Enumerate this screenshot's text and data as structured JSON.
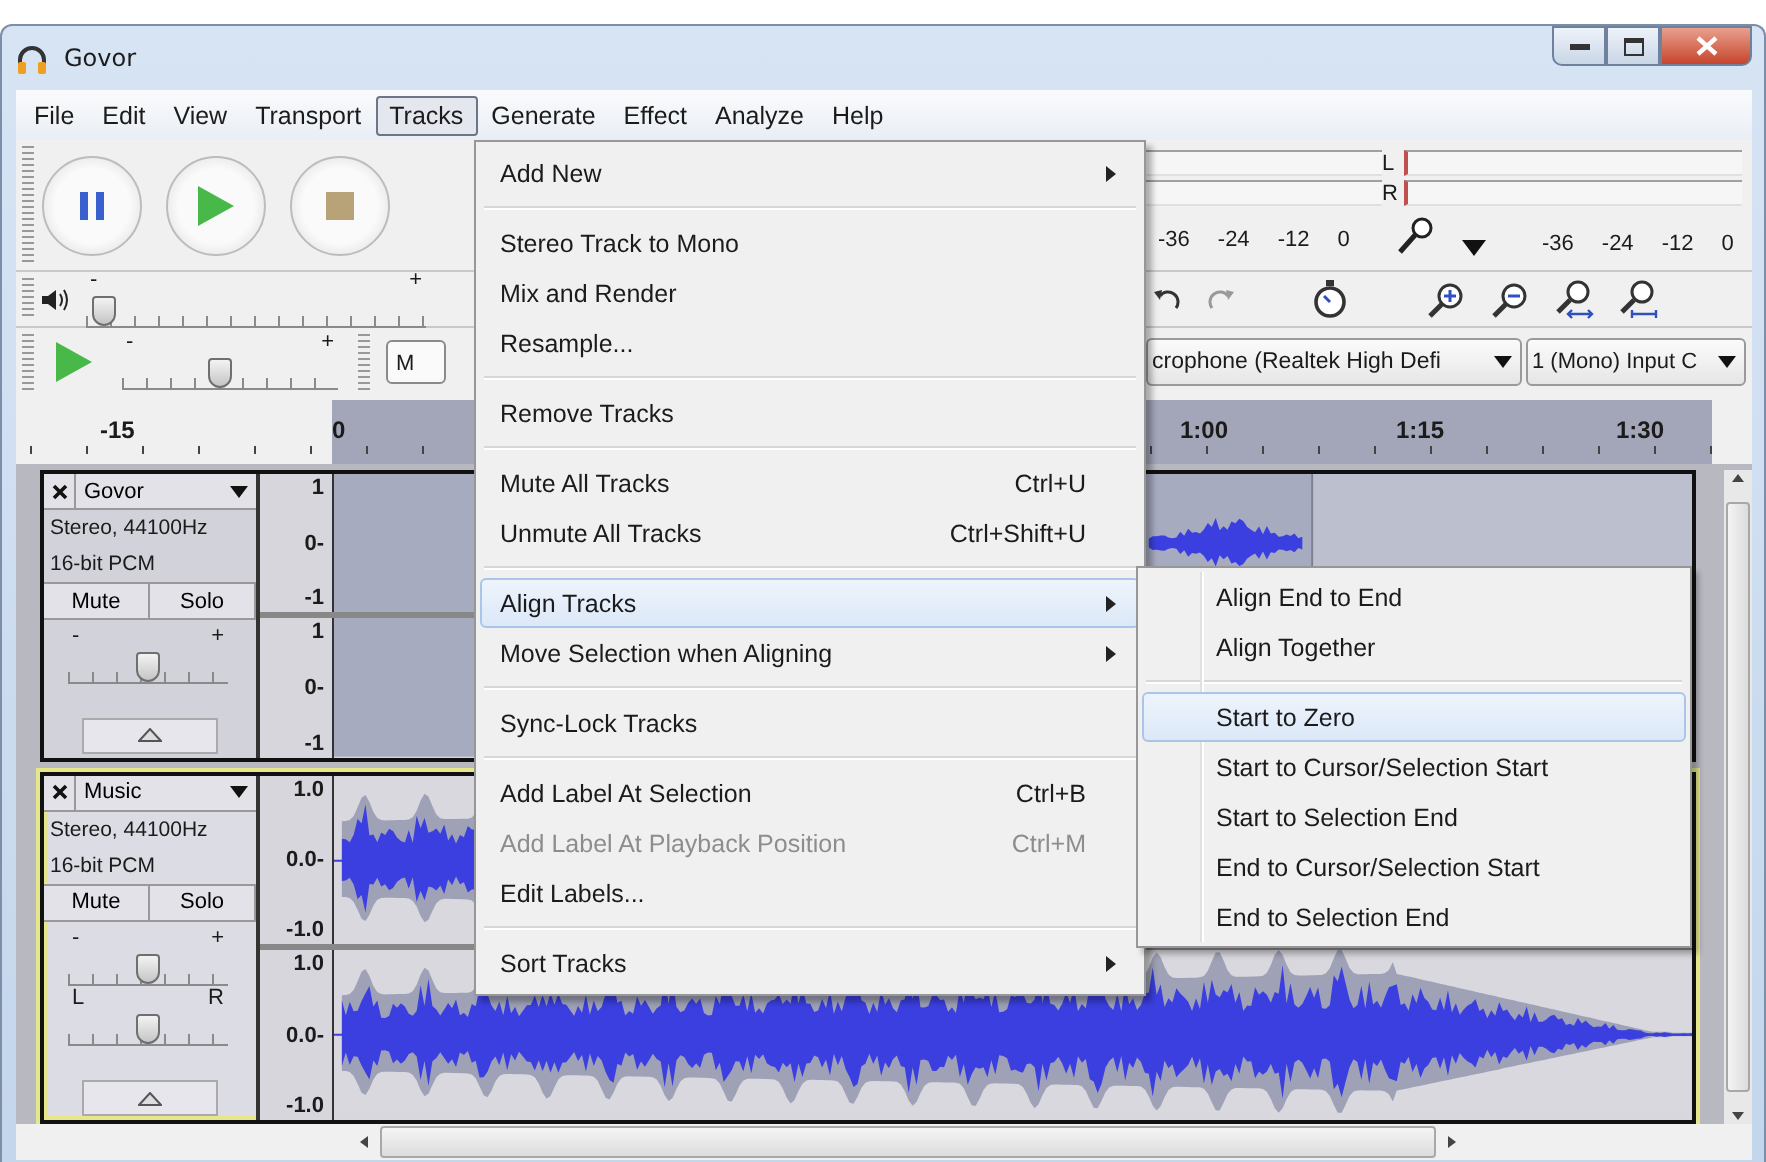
{
  "window": {
    "title": "Govor"
  },
  "menu_bar": [
    {
      "label": "File",
      "selected": false
    },
    {
      "label": "Edit",
      "selected": false
    },
    {
      "label": "View",
      "selected": false
    },
    {
      "label": "Transport",
      "selected": false
    },
    {
      "label": "Tracks",
      "selected": true
    },
    {
      "label": "Generate",
      "selected": false
    },
    {
      "label": "Effect",
      "selected": false
    },
    {
      "label": "Analyze",
      "selected": false
    },
    {
      "label": "Help",
      "selected": false
    }
  ],
  "meter_toolbar": {
    "channels": [
      "L",
      "R"
    ],
    "playback_scale": [
      "-36",
      "-24",
      "-12",
      "0"
    ],
    "recording_scale": [
      "-36",
      "-24",
      "-12",
      "0"
    ]
  },
  "mixer_toolbar": {
    "volume_slider": {
      "min_label": "-",
      "max_label": "+",
      "level": 0.02
    }
  },
  "transcription_toolbar": {
    "speed_slider": {
      "min_label": "-",
      "max_label": "+",
      "level": 0.45
    },
    "partial_box": "M"
  },
  "device_toolbar": {
    "input_device": "crophone (Realtek High Defi",
    "input_channels": "1 (Mono) Input C"
  },
  "timeline": {
    "labels": [
      "-15",
      "0",
      "1:00",
      "1:15",
      "1:30"
    ]
  },
  "tracks": [
    {
      "name": "Govor",
      "format": "Stereo, 44100Hz",
      "sample_format": "16-bit PCM",
      "mute": "Mute",
      "solo": "Solo",
      "selected": false,
      "sliders": [
        {
          "kind": "gain",
          "min_label": "-",
          "max_label": "+",
          "level": 0.5
        }
      ],
      "channels": [
        {
          "scale": [
            "1",
            "0-",
            "-1"
          ]
        },
        {
          "scale": [
            "1",
            "0-",
            "-1"
          ]
        }
      ]
    },
    {
      "name": "Music",
      "format": "Stereo, 44100Hz",
      "sample_format": "16-bit PCM",
      "mute": "Mute",
      "solo": "Solo",
      "selected": true,
      "sliders": [
        {
          "kind": "gain",
          "min_label": "-",
          "max_label": "+",
          "level": 0.5
        },
        {
          "kind": "pan",
          "min_label": "L",
          "max_label": "R",
          "level": 0.5
        }
      ],
      "channels": [
        {
          "scale": [
            "1.0",
            "0.0-",
            "-1.0"
          ]
        },
        {
          "scale": [
            "1.0",
            "0.0-",
            "-1.0"
          ]
        }
      ]
    }
  ],
  "tracks_menu": [
    {
      "kind": "item",
      "label": "Add New",
      "has_submenu": true,
      "selected": false,
      "disabled": false
    },
    {
      "kind": "separator"
    },
    {
      "kind": "item",
      "label": "Stereo Track to Mono",
      "has_submenu": false,
      "selected": false,
      "disabled": false
    },
    {
      "kind": "item",
      "label": "Mix and Render",
      "has_submenu": false,
      "selected": false,
      "disabled": false
    },
    {
      "kind": "item",
      "label": "Resample...",
      "has_submenu": false,
      "selected": false,
      "disabled": false
    },
    {
      "kind": "separator"
    },
    {
      "kind": "item",
      "label": "Remove Tracks",
      "has_submenu": false,
      "selected": false,
      "disabled": false
    },
    {
      "kind": "separator"
    },
    {
      "kind": "item",
      "label": "Mute All Tracks",
      "shortcut": "Ctrl+U",
      "has_submenu": false,
      "selected": false,
      "disabled": false
    },
    {
      "kind": "item",
      "label": "Unmute All Tracks",
      "shortcut": "Ctrl+Shift+U",
      "has_submenu": false,
      "selected": false,
      "disabled": false
    },
    {
      "kind": "separator"
    },
    {
      "kind": "item",
      "label": "Align Tracks",
      "has_submenu": true,
      "selected": true,
      "disabled": false
    },
    {
      "kind": "item",
      "label": "Move Selection when Aligning",
      "has_submenu": true,
      "selected": false,
      "disabled": false
    },
    {
      "kind": "separator"
    },
    {
      "kind": "item",
      "label": "Sync-Lock Tracks",
      "has_submenu": false,
      "selected": false,
      "disabled": false
    },
    {
      "kind": "separator"
    },
    {
      "kind": "item",
      "label": "Add Label At Selection",
      "shortcut": "Ctrl+B",
      "has_submenu": false,
      "selected": false,
      "disabled": false
    },
    {
      "kind": "item",
      "label": "Add Label At Playback Position",
      "shortcut": "Ctrl+M",
      "has_submenu": false,
      "selected": false,
      "disabled": true
    },
    {
      "kind": "item",
      "label": "Edit Labels...",
      "has_submenu": false,
      "selected": false,
      "disabled": false
    },
    {
      "kind": "separator"
    },
    {
      "kind": "item",
      "label": "Sort Tracks",
      "has_submenu": true,
      "selected": false,
      "disabled": false
    }
  ],
  "align_submenu": [
    {
      "kind": "item",
      "label": "Align End to End",
      "selected": false
    },
    {
      "kind": "item",
      "label": "Align Together",
      "selected": false
    },
    {
      "kind": "separator"
    },
    {
      "kind": "item",
      "label": "Start to Zero",
      "selected": true
    },
    {
      "kind": "item",
      "label": "Start to Cursor/Selection Start",
      "selected": false
    },
    {
      "kind": "item",
      "label": "Start to Selection End",
      "selected": false
    },
    {
      "kind": "item",
      "label": "End to Cursor/Selection Start",
      "selected": false
    },
    {
      "kind": "item",
      "label": "End to Selection End",
      "selected": false
    }
  ]
}
